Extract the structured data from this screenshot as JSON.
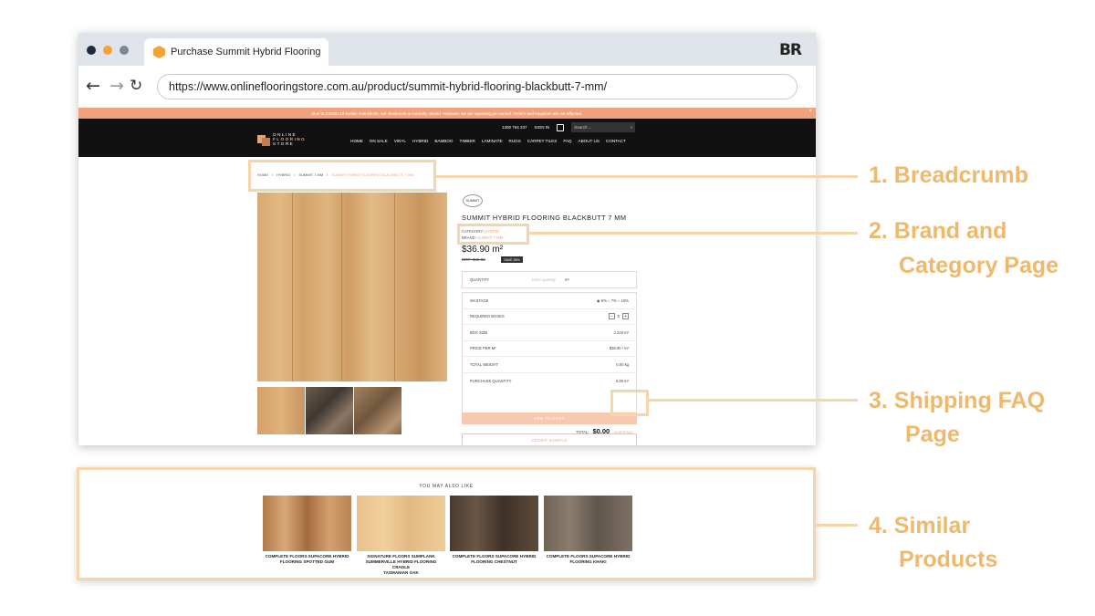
{
  "browser": {
    "tab_title": "Purchase Summit Hybrid Flooring",
    "logo": "BR",
    "url": "https://www.onlineflooringstore.com.au/product/summit-hybrid-flooring-blackbutt-7-mm/",
    "nav": {
      "back": "←",
      "forward": "→",
      "reload": "↻"
    }
  },
  "site": {
    "notice": "Due to COVID-19 border restrictions, our showroom is currently closed. However, we are operating as normal. Orders and enquiries are not affected.",
    "phone": "1300 764 237",
    "signin": "SIGN IN",
    "search_placeholder": "Search ...",
    "logo_line1": "ONLINE",
    "logo_line2": "FLOORING",
    "logo_line3": "STORE",
    "nav": [
      "HOME",
      "ON SALE",
      "VINYL",
      "HYBRID",
      "BAMBOO",
      "TIMBER",
      "LAMINATE",
      "RUGS",
      "CARPET TILES",
      "FAQ",
      "ABOUT US",
      "CONTACT"
    ]
  },
  "breadcrumb": {
    "items": [
      "HOME",
      "/",
      "HYBRID",
      "/",
      "SUMMIT 7 MM",
      "/"
    ],
    "current": "SUMMIT HYBRID FLOORING BLACKBUTT 7 MM"
  },
  "product": {
    "brand_badge": "SUMMIT",
    "title": "SUMMIT HYBRID FLOORING BLACKBUTT 7 MM",
    "code_label": "PRODUCT CODE:",
    "code": "SUMHYB7MMBB",
    "category_label": "CATEGORY:",
    "category": "HYBRID",
    "brand_label": "BRAND:",
    "brand": "SUMMIT 7 MM",
    "price": "$36.90 m²",
    "rrp": "RRP: $49.95",
    "save_badge": "SAVE 26%",
    "quantity_label": "QUANTITY",
    "quantity_placeholder": "Enter quantity",
    "quantity_unit": "m²",
    "options": [
      {
        "label": "WASTAGE",
        "value": "◉ 5% ○ 7% ○ 10%"
      },
      {
        "label": "REQUIRED BOXES",
        "value": "0"
      },
      {
        "label": "BOX SIZE",
        "value": "2.218 m²"
      },
      {
        "label": "PRICE PER M²",
        "value": "$36.90 / m²"
      },
      {
        "label": "TOTAL WEIGHT",
        "value": "0.00 kg"
      },
      {
        "label": "PURCHASE QUANTITY",
        "value": "0.00 m²"
      }
    ],
    "total_label": "TOTAL:",
    "total": "$0.00",
    "shipping_link": "(SHIPPING)",
    "add_to_cart": "ADD TO CART",
    "order_sample": "ORDER SAMPLE",
    "below_thumb": "DELIVERY & RETURNS"
  },
  "callouts": {
    "c1": "1. Breadcrumb",
    "c2a": "2. Brand and",
    "c2b": "Category Page",
    "c3a": "3. Shipping FAQ",
    "c3b": "Page",
    "c4a": "4. Similar",
    "c4b": "Products"
  },
  "similar": {
    "title": "YOU MAY ALSO LIKE",
    "products": [
      {
        "name_l1": "COMPLETE FLOORS SUPACORE HYBRID",
        "name_l2": "FLOORING SPOTTED GUM",
        "name_l3": ""
      },
      {
        "name_l1": "SIGNATURE FLOORS SUMPLANK",
        "name_l2": "SUMMERVILLE HYBRID FLOORING CRADLE",
        "name_l3": "TASMANIAN OAK"
      },
      {
        "name_l1": "COMPLETE FLOORS SUPACORE HYBRID",
        "name_l2": "FLOORING CHESTNUT",
        "name_l3": ""
      },
      {
        "name_l1": "COMPLETE FLOORS SUPACORE HYBRID",
        "name_l2": "FLOORING KHAKI",
        "name_l3": ""
      }
    ]
  },
  "colors": {
    "accent": "#f2a27a",
    "highlight": "#f6d6a8",
    "callout_text": "#efb86a",
    "header_bg": "#111111"
  }
}
